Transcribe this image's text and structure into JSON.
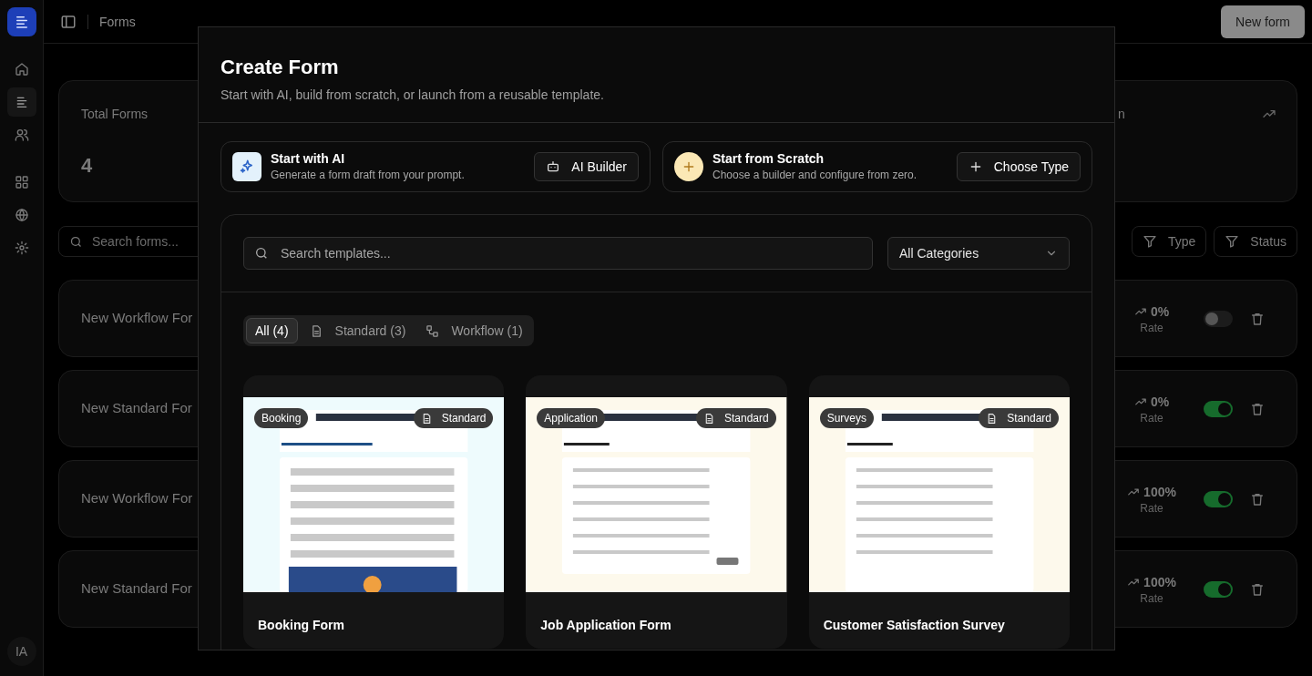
{
  "sidebar": {
    "items": [
      {
        "kind": "home",
        "selected": false
      },
      {
        "kind": "forms",
        "selected": true
      },
      {
        "kind": "users",
        "selected": false
      },
      {
        "kind": "grid",
        "selected": false
      },
      {
        "kind": "globe",
        "selected": false
      },
      {
        "kind": "settings",
        "selected": false
      }
    ],
    "avatar": "IA"
  },
  "topbar": {
    "breadcrumb": "Forms",
    "new_button": "New form"
  },
  "stats": [
    {
      "title": "Total Forms",
      "value": "4"
    },
    {
      "title": "n"
    }
  ],
  "search": {
    "placeholder": "Search forms..."
  },
  "filters": [
    "Type",
    "Status"
  ],
  "forms": [
    {
      "name": "New Workflow For",
      "rate": "0%",
      "rate_label": "Rate",
      "on": false
    },
    {
      "name": "New Standard For",
      "rate": "0%",
      "rate_label": "Rate",
      "on": true
    },
    {
      "name": "New Workflow For",
      "rate": "100%",
      "rate_label": "Rate",
      "on": true
    },
    {
      "name": "New Standard For",
      "rate": "100%",
      "rate_label": "Rate",
      "on": true
    }
  ],
  "modal": {
    "title": "Create Form",
    "subtitle": "Start with AI, build from scratch, or launch from a reusable template.",
    "actions": [
      {
        "kind": "ai",
        "title": "Start with AI",
        "description": "Generate a form draft from your prompt.",
        "button": "AI Builder"
      },
      {
        "kind": "scratch",
        "title": "Start from Scratch",
        "description": "Choose a builder and configure from zero.",
        "button": "Choose Type"
      }
    ],
    "template_search": {
      "placeholder": "Search templates..."
    },
    "category": "All Categories",
    "tabs": [
      {
        "kind": "all",
        "label": "All (4)",
        "selected": true
      },
      {
        "kind": "standard",
        "label": "Standard (3)",
        "selected": false
      },
      {
        "kind": "workflow",
        "label": "Workflow (1)",
        "selected": false
      }
    ],
    "templates": [
      {
        "title": "Booking Form",
        "category": "Booking",
        "type": "Standard"
      },
      {
        "title": "Job Application Form",
        "category": "Application",
        "type": "Standard"
      },
      {
        "title": "Customer Satisfaction Survey",
        "category": "Surveys",
        "type": "Standard"
      }
    ]
  }
}
